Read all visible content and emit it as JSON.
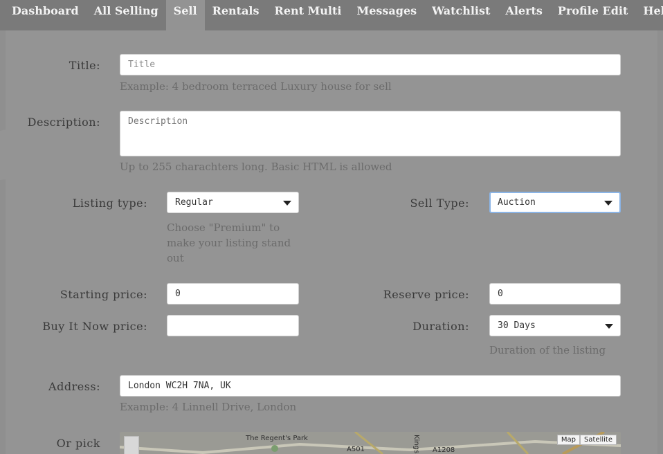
{
  "nav": {
    "items": [
      "Dashboard",
      "All Selling",
      "Sell",
      "Rentals",
      "Rent Multi",
      "Messages",
      "Watchlist",
      "Alerts",
      "Profile Edit",
      "Help"
    ],
    "active": "Sell"
  },
  "form": {
    "title": {
      "label": "Title:",
      "placeholder": "Title",
      "hint": "Example: 4 bedroom terraced Luxury house for sell"
    },
    "description": {
      "label": "Description:",
      "placeholder": "Description",
      "hint": "Up to 255 charachters long. Basic HTML is allowed"
    },
    "listing_type": {
      "label": "Listing type:",
      "value": "Regular",
      "hint": "Choose \"Premium\" to make your listing stand out"
    },
    "sell_type": {
      "label": "Sell Type:",
      "value": "Auction"
    },
    "starting_price": {
      "label": "Starting price:",
      "value": "0"
    },
    "reserve_price": {
      "label": "Reserve price:",
      "value": "0"
    },
    "buy_it_now": {
      "label": "Buy It Now price:",
      "value": ""
    },
    "duration": {
      "label": "Duration:",
      "value": "30 Days",
      "hint": "Duration of the listing"
    },
    "address": {
      "label": "Address:",
      "value": "London WC2H 7NA, UK",
      "hint": "Example: 4 Linnell Drive, London"
    },
    "or_pick": {
      "label": "Or pick"
    }
  },
  "map": {
    "labels": [
      "The Regent's Park",
      "A501",
      "A1208",
      "Kingsl"
    ],
    "map_button": "Map",
    "satellite_button": "Satellite"
  }
}
